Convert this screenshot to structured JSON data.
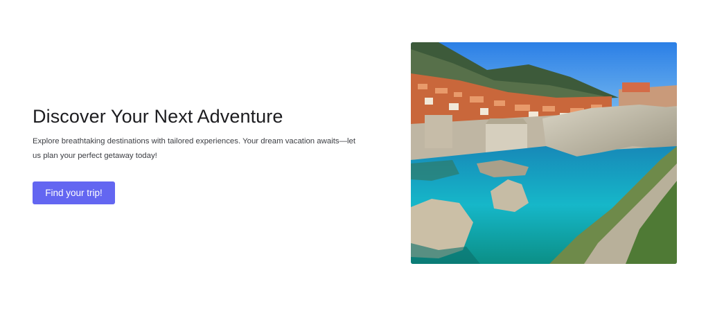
{
  "hero": {
    "title": "Discover Your Next Adventure",
    "description": "Explore breathtaking destinations with tailored experiences. Your dream vacation awaits—let us plan your perfect getaway today!",
    "cta_label": "Find your trip!"
  },
  "colors": {
    "accent": "#6366f1",
    "title": "#1c1c1f",
    "body_text": "#3b3d42",
    "background": "#ffffff"
  },
  "image": {
    "subject": "coastal-walled-city-photo"
  }
}
